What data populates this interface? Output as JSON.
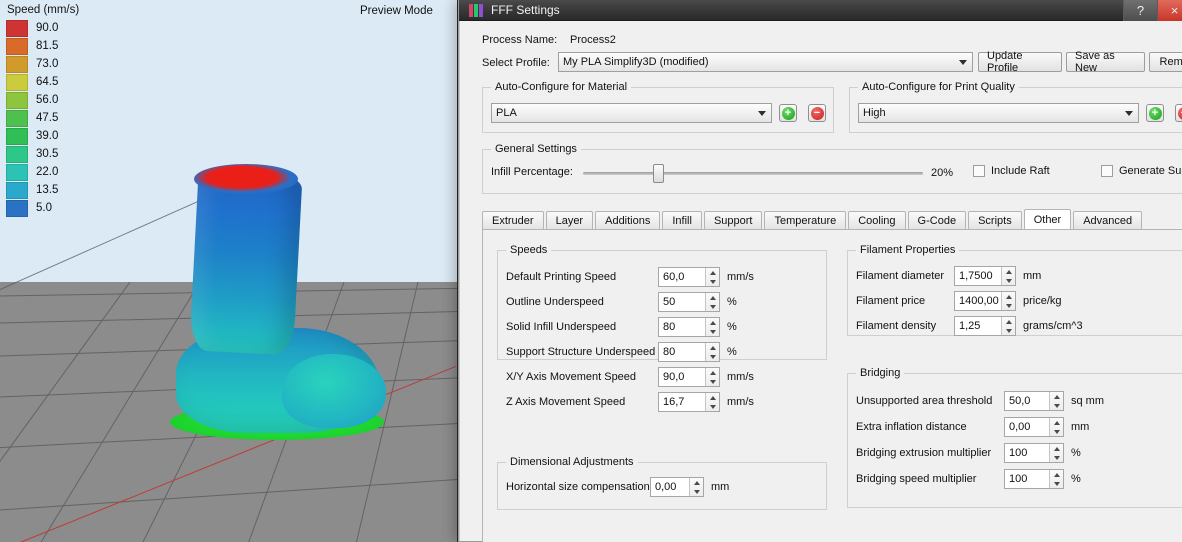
{
  "viewport": {
    "preview_mode_label": "Preview Mode",
    "legend_title": "Speed (mm/s)",
    "legend": [
      {
        "value": "90.0",
        "color": "#cf3434"
      },
      {
        "value": "81.5",
        "color": "#d96a28"
      },
      {
        "value": "73.0",
        "color": "#d19b2c"
      },
      {
        "value": "64.5",
        "color": "#cbcb3e"
      },
      {
        "value": "56.0",
        "color": "#8dc53f"
      },
      {
        "value": "47.5",
        "color": "#4ec04e"
      },
      {
        "value": "39.0",
        "color": "#2fbf56"
      },
      {
        "value": "30.5",
        "color": "#2ec78a"
      },
      {
        "value": "22.0",
        "color": "#2cc3b5"
      },
      {
        "value": "13.5",
        "color": "#2aa9cc"
      },
      {
        "value": "5.0",
        "color": "#2a72c4"
      }
    ]
  },
  "window": {
    "title": "FFF Settings",
    "help_label": "?",
    "close_label": "×",
    "icon_colors": [
      "#d8436b",
      "#25c96a",
      "#8f4fd0"
    ]
  },
  "header": {
    "process_name_label": "Process Name:",
    "process_name_value": "Process2",
    "select_profile_label": "Select Profile:",
    "select_profile_value": "My PLA Simplify3D (modified)",
    "update_profile_label": "Update Profile",
    "save_as_new_label": "Save as New",
    "remove_label": "Remove"
  },
  "auto_material": {
    "title": "Auto-Configure for Material",
    "value": "PLA",
    "add_label": "+",
    "remove_label": "−"
  },
  "auto_quality": {
    "title": "Auto-Configure for Print Quality",
    "value": "High",
    "add_label": "+",
    "remove_label": "−"
  },
  "general": {
    "title": "General Settings",
    "infill_label": "Infill Percentage:",
    "infill_value": "20%",
    "include_raft_label": "Include Raft",
    "include_raft_checked": false,
    "generate_support_label": "Generate Support",
    "generate_support_checked": false
  },
  "tabs": [
    {
      "label": "Extruder",
      "active": false
    },
    {
      "label": "Layer",
      "active": false
    },
    {
      "label": "Additions",
      "active": false
    },
    {
      "label": "Infill",
      "active": false
    },
    {
      "label": "Support",
      "active": false
    },
    {
      "label": "Temperature",
      "active": false
    },
    {
      "label": "Cooling",
      "active": false
    },
    {
      "label": "G-Code",
      "active": false
    },
    {
      "label": "Scripts",
      "active": false
    },
    {
      "label": "Other",
      "active": true
    },
    {
      "label": "Advanced",
      "active": false
    }
  ],
  "speeds": {
    "title": "Speeds",
    "rows": [
      {
        "label": "Default Printing Speed",
        "value": "60,0",
        "unit": "mm/s"
      },
      {
        "label": "Outline Underspeed",
        "value": "50",
        "unit": "%"
      },
      {
        "label": "Solid Infill Underspeed",
        "value": "80",
        "unit": "%"
      },
      {
        "label": "Support Structure Underspeed",
        "value": "80",
        "unit": "%"
      },
      {
        "label": "X/Y Axis Movement Speed",
        "value": "90,0",
        "unit": "mm/s"
      },
      {
        "label": "Z Axis Movement Speed",
        "value": "16,7",
        "unit": "mm/s"
      }
    ]
  },
  "dimensional": {
    "title": "Dimensional Adjustments",
    "rows": [
      {
        "label": "Horizontal size compensation",
        "value": "0,00",
        "unit": "mm"
      }
    ]
  },
  "filament": {
    "title": "Filament Properties",
    "rows": [
      {
        "label": "Filament diameter",
        "value": "1,7500",
        "unit": "mm"
      },
      {
        "label": "Filament price",
        "value": "1400,00",
        "unit": "price/kg"
      },
      {
        "label": "Filament density",
        "value": "1,25",
        "unit": "grams/cm^3"
      }
    ]
  },
  "bridging": {
    "title": "Bridging",
    "rows": [
      {
        "label": "Unsupported area threshold",
        "value": "50,0",
        "unit": "sq mm"
      },
      {
        "label": "Extra inflation distance",
        "value": "0,00",
        "unit": "mm"
      },
      {
        "label": "Bridging extrusion multiplier",
        "value": "100",
        "unit": "%"
      },
      {
        "label": "Bridging speed multiplier",
        "value": "100",
        "unit": "%"
      }
    ]
  }
}
